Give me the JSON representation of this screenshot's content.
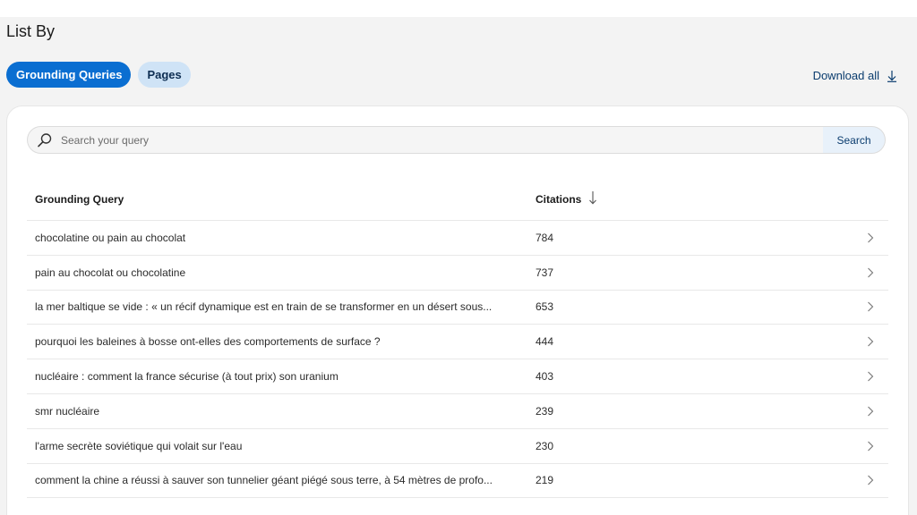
{
  "section": {
    "title": "List By"
  },
  "tabs": [
    {
      "label": "Grounding Queries",
      "active": true
    },
    {
      "label": "Pages",
      "active": false
    }
  ],
  "download": {
    "label": "Download all",
    "icon": "download-arrow-icon"
  },
  "search": {
    "placeholder": "Search your query",
    "value": "",
    "button_label": "Search",
    "icon": "search-icon"
  },
  "table": {
    "columns": {
      "query": "Grounding Query",
      "citations": "Citations",
      "sort_icon": "sort-descending-arrow-icon"
    },
    "rows": [
      {
        "query": "chocolatine ou pain au chocolat",
        "citations": "784"
      },
      {
        "query": "pain au chocolat ou chocolatine",
        "citations": "737"
      },
      {
        "query": "la mer baltique se vide : « un récif dynamique est en train de se transformer en un désert sous...",
        "citations": "653"
      },
      {
        "query": "pourquoi les baleines à bosse ont-elles des comportements de surface ?",
        "citations": "444"
      },
      {
        "query": "nucléaire : comment la france sécurise (à tout prix) son uranium",
        "citations": "403"
      },
      {
        "query": "smr nucléaire",
        "citations": "239"
      },
      {
        "query": "l'arme secrète soviétique qui volait sur l'eau",
        "citations": "230"
      },
      {
        "query": "comment la chine a réussi à sauver son tunnelier géant piégé sous terre, à 54 mètres de profo...",
        "citations": "219"
      }
    ]
  },
  "colors": {
    "accent": "#0a6ed1",
    "inactive_pill": "#cfe3f6",
    "page_background": "#f3f3f3",
    "card_background": "#ffffff"
  }
}
